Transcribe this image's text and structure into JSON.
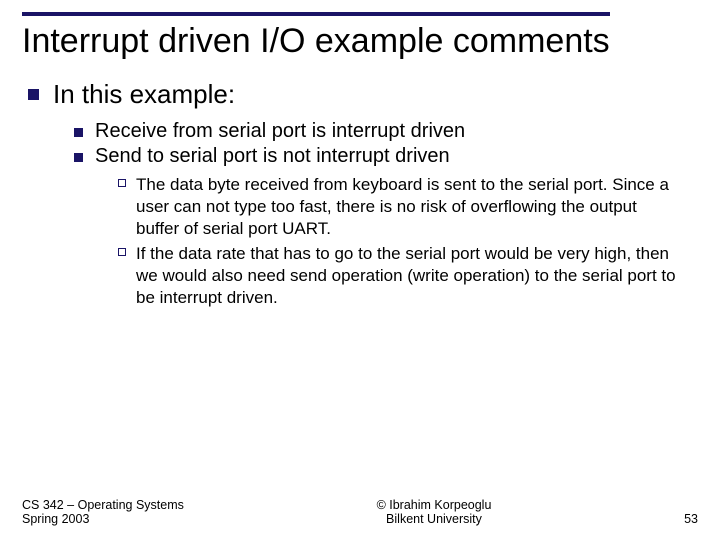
{
  "title": "Interrupt driven I/O example comments",
  "l1_text": "In this example:",
  "l2": {
    "a": "Receive from serial port is interrupt driven",
    "b": "Send to serial port is  not interrupt driven"
  },
  "l3": {
    "a": "The data byte received from keyboard is sent to the serial port. Since a user can not type too fast, there is no risk of overflowing the output buffer of serial port UART.",
    "b": "If the data rate that has to go to the serial port would be very high, then we would also need send operation (write operation) to the serial port to be interrupt driven."
  },
  "footer": {
    "left1": "CS 342 – Operating Systems",
    "left2": "Spring 2003",
    "center1": "© Ibrahim Korpeoglu",
    "center2": "Bilkent University",
    "right": "53"
  }
}
